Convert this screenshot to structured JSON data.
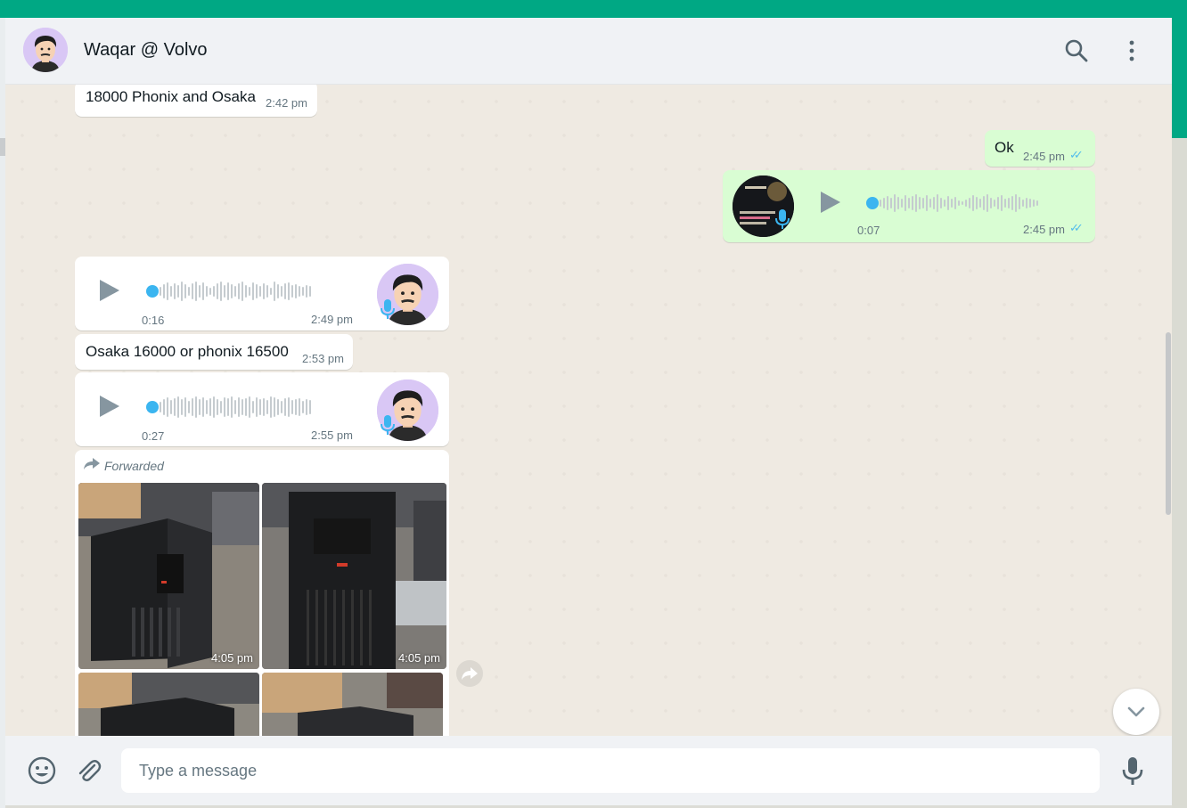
{
  "header": {
    "contact_name": "Waqar @ Volvo"
  },
  "messages": [
    {
      "type": "text",
      "direction": "in",
      "text": "18000 Phonix and Osaka",
      "time": "2:42 pm"
    },
    {
      "type": "text",
      "direction": "out",
      "text": "Ok",
      "time": "2:45 pm",
      "status": "read"
    },
    {
      "type": "voice",
      "direction": "out",
      "duration": "0:07",
      "time": "2:45 pm",
      "status": "read"
    },
    {
      "type": "voice",
      "direction": "in",
      "duration": "0:16",
      "time": "2:49 pm"
    },
    {
      "type": "text",
      "direction": "in",
      "text": "Osaka 16000 or phonix 16500",
      "time": "2:53 pm"
    },
    {
      "type": "voice",
      "direction": "in",
      "duration": "0:27",
      "time": "2:55 pm"
    },
    {
      "type": "album",
      "direction": "in",
      "forwarded_label": "Forwarded",
      "photo_times": [
        "4:05 pm",
        "4:05 pm"
      ]
    }
  ],
  "composer": {
    "placeholder": "Type a message"
  },
  "colors": {
    "accent": "#00a884",
    "outgoing_bubble": "#d9fdd3",
    "read_ticks": "#53bdeb",
    "voice_dot": "#3bb5f0"
  },
  "icons": [
    "search-icon",
    "menu-dots-icon",
    "play-icon",
    "microphone-icon",
    "forward-icon",
    "chevron-down-icon",
    "emoji-icon",
    "attach-icon"
  ]
}
